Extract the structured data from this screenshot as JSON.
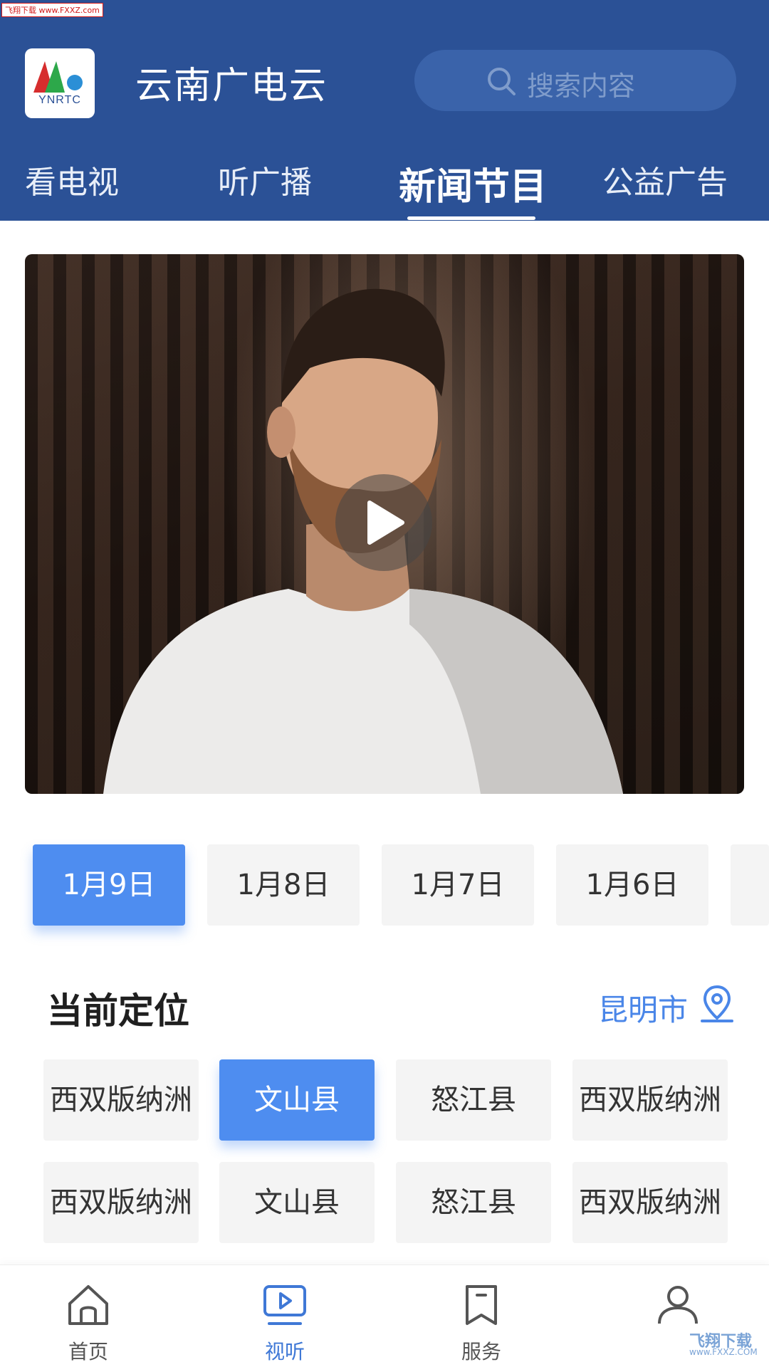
{
  "watermark": {
    "top_text": "飞翔下载 www.FXXZ.com",
    "bottom_text": "飞翔下载",
    "bottom_url": "www.FXXZ.COM"
  },
  "header": {
    "logo_text": "YNRTC",
    "title": "云南广电云",
    "search_placeholder": "搜索内容",
    "colors": {
      "background": "#2b5196",
      "search_bg": "#3a63aa"
    }
  },
  "tabs": [
    {
      "label": "看电视",
      "active": false
    },
    {
      "label": "听广播",
      "active": false
    },
    {
      "label": "新闻节目",
      "active": true
    },
    {
      "label": "公益广告",
      "active": false
    }
  ],
  "video": {
    "play_icon": "play-icon"
  },
  "dates": [
    {
      "label": "1月9日",
      "active": true
    },
    {
      "label": "1月8日",
      "active": false
    },
    {
      "label": "1月7日",
      "active": false
    },
    {
      "label": "1月6日",
      "active": false
    }
  ],
  "location": {
    "title": "当前定位",
    "city": "昆明市",
    "pin_icon": "location-pin-icon",
    "regions": [
      {
        "label": "西双版纳洲",
        "active": false
      },
      {
        "label": "文山县",
        "active": true
      },
      {
        "label": "怒江县",
        "active": false
      },
      {
        "label": "西双版纳洲",
        "active": false
      },
      {
        "label": "西双版纳洲",
        "active": false
      },
      {
        "label": "文山县",
        "active": false
      },
      {
        "label": "怒江县",
        "active": false
      },
      {
        "label": "西双版纳洲",
        "active": false
      }
    ]
  },
  "bottom_nav": [
    {
      "label": "首页",
      "icon": "home-icon",
      "active": false
    },
    {
      "label": "视听",
      "icon": "tv-play-icon",
      "active": true
    },
    {
      "label": "服务",
      "icon": "bookmark-icon",
      "active": false
    },
    {
      "label": "",
      "icon": "user-icon",
      "active": false
    }
  ],
  "accent_color": "#4e8df0"
}
